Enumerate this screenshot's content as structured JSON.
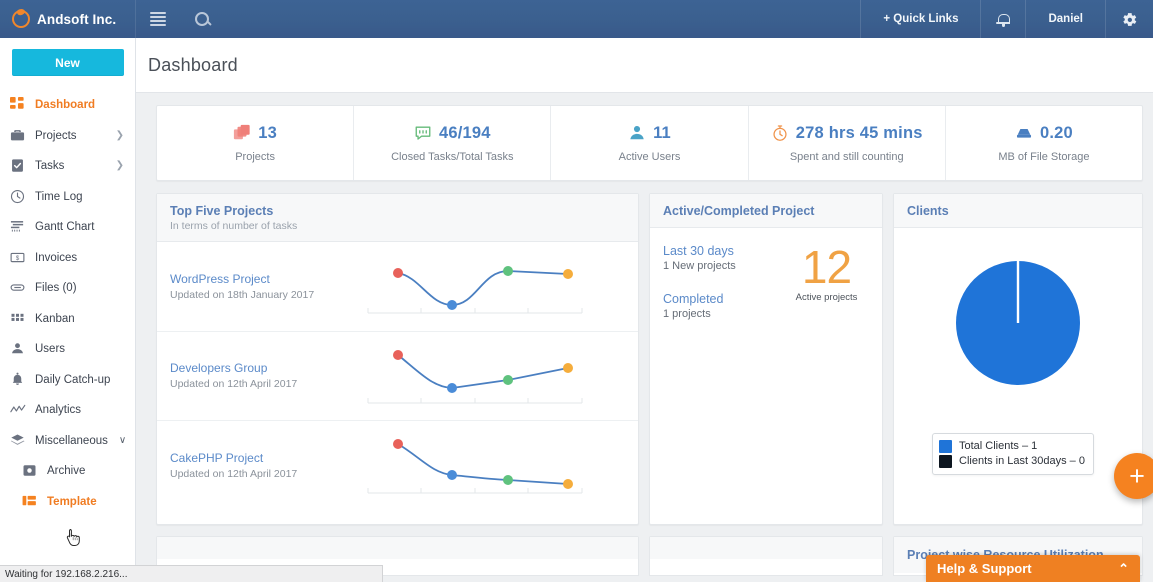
{
  "header": {
    "brand": "Andsoft Inc.",
    "menu_icon": "hamburger-icon",
    "search_icon": "search-icon",
    "quick_links": "+ Quick Links",
    "notifications_icon": "bell-icon",
    "user": "Daniel",
    "settings_icon": "gear-icon"
  },
  "sidebar": {
    "new_button": "New",
    "items": [
      {
        "label": "Dashboard",
        "icon": "grid-icon",
        "active": true,
        "chevron": false,
        "sub": false
      },
      {
        "label": "Projects",
        "icon": "briefcase-icon",
        "active": false,
        "chevron": true,
        "sub": false
      },
      {
        "label": "Tasks",
        "icon": "clipboard-check-icon",
        "active": false,
        "chevron": true,
        "sub": false
      },
      {
        "label": "Time Log",
        "icon": "clock-icon",
        "active": false,
        "chevron": false,
        "sub": false
      },
      {
        "label": "Gantt Chart",
        "icon": "gantt-icon",
        "active": false,
        "chevron": false,
        "sub": false
      },
      {
        "label": "Invoices",
        "icon": "money-icon",
        "active": false,
        "chevron": false,
        "sub": false
      },
      {
        "label": "Files  (0)",
        "icon": "paperclip-icon",
        "active": false,
        "chevron": false,
        "sub": false
      },
      {
        "label": "Kanban",
        "icon": "kanban-icon",
        "active": false,
        "chevron": false,
        "sub": false
      },
      {
        "label": "Users",
        "icon": "user-icon",
        "active": false,
        "chevron": false,
        "sub": false
      },
      {
        "label": "Daily Catch-up",
        "icon": "bell-alert-icon",
        "active": false,
        "chevron": false,
        "sub": false
      },
      {
        "label": "Analytics",
        "icon": "line-chart-icon",
        "active": false,
        "chevron": false,
        "sub": false
      },
      {
        "label": "Miscellaneous",
        "icon": "layers-icon",
        "active": false,
        "chevron": false,
        "sub": false,
        "caret": "∨"
      },
      {
        "label": "Archive",
        "icon": "archive-icon",
        "active": false,
        "chevron": false,
        "sub": true
      },
      {
        "label": "Template",
        "icon": "template-icon",
        "active": true,
        "chevron": false,
        "sub": true
      }
    ]
  },
  "page": {
    "title": "Dashboard"
  },
  "stats": [
    {
      "value": "13",
      "label": "Projects",
      "icon": "projects-icon",
      "color": "#ef7f79"
    },
    {
      "value": "46/194",
      "label": "Closed Tasks/Total Tasks",
      "icon": "tasks-icon",
      "color": "#66bb7a"
    },
    {
      "value": "11",
      "label": "Active Users",
      "icon": "users-icon",
      "color": "#4aa3c7"
    },
    {
      "value": "278 hrs 45 mins",
      "label": "Spent and still counting",
      "icon": "stopwatch-icon",
      "color": "#f0934a"
    },
    {
      "value": "0.20",
      "label": "MB of File Storage",
      "icon": "storage-icon",
      "color": "#4a7fc1"
    }
  ],
  "top_five": {
    "title": "Top Five Projects",
    "subtitle": "In terms of number of tasks",
    "projects": [
      {
        "name": "WordPress Project",
        "updated": "Updated on 18th January 2017"
      },
      {
        "name": "Developers Group",
        "updated": "Updated on 12th April 2017"
      },
      {
        "name": "CakePHP Project",
        "updated": "Updated on 12th April 2017"
      }
    ]
  },
  "active_completed": {
    "title": "Active/Completed Project",
    "last_30_days_label": "Last 30 days",
    "last_30_days_value": "1 New projects",
    "completed_label": "Completed",
    "completed_value": "1 projects",
    "big_number": "12",
    "big_caption": "Active projects"
  },
  "clients": {
    "title": "Clients",
    "legend": [
      {
        "text": "Total Clients – 1",
        "color": "#1f74d8"
      },
      {
        "text": "Clients in Last 30days – 0",
        "color": "#0d1620"
      }
    ],
    "add_button": "+"
  },
  "bottom_panels": [
    {
      "title": ""
    },
    {
      "title": ""
    },
    {
      "title": "Project wise Resource Utilization"
    }
  ],
  "help": {
    "label": "Help & Support",
    "chevron": "⌃"
  },
  "statusbar": {
    "text": "Waiting for 192.168.2.216..."
  },
  "chart_data": [
    {
      "type": "line",
      "title": "WordPress Project",
      "x": [
        1,
        2,
        3,
        4
      ],
      "values": [
        72,
        18,
        80,
        74
      ],
      "point_colors": [
        "#e8615a",
        "#4a8cd8",
        "#5fc27e",
        "#f5ad3c"
      ],
      "line_color": "#4a7fc1",
      "ylim": [
        0,
        100
      ],
      "grid": false,
      "legend": "none"
    },
    {
      "type": "line",
      "title": "Developers Group",
      "x": [
        1,
        2,
        3,
        4
      ],
      "values": [
        88,
        22,
        34,
        58
      ],
      "point_colors": [
        "#e8615a",
        "#4a8cd8",
        "#5fc27e",
        "#f5ad3c"
      ],
      "line_color": "#4a7fc1",
      "ylim": [
        0,
        100
      ],
      "grid": false,
      "legend": "none"
    },
    {
      "type": "line",
      "title": "CakePHP Project",
      "x": [
        1,
        2,
        3,
        4
      ],
      "values": [
        90,
        30,
        22,
        14
      ],
      "point_colors": [
        "#e8615a",
        "#4a8cd8",
        "#5fc27e",
        "#f5ad3c"
      ],
      "line_color": "#4a7fc1",
      "ylim": [
        0,
        100
      ],
      "grid": false,
      "legend": "none"
    },
    {
      "type": "pie",
      "title": "Clients",
      "labels": [
        "Total Clients",
        "Clients in Last 30days"
      ],
      "values": [
        1,
        0
      ],
      "colors": [
        "#1f74d8",
        "#0d1620"
      ],
      "legend": "bottom-left"
    }
  ]
}
